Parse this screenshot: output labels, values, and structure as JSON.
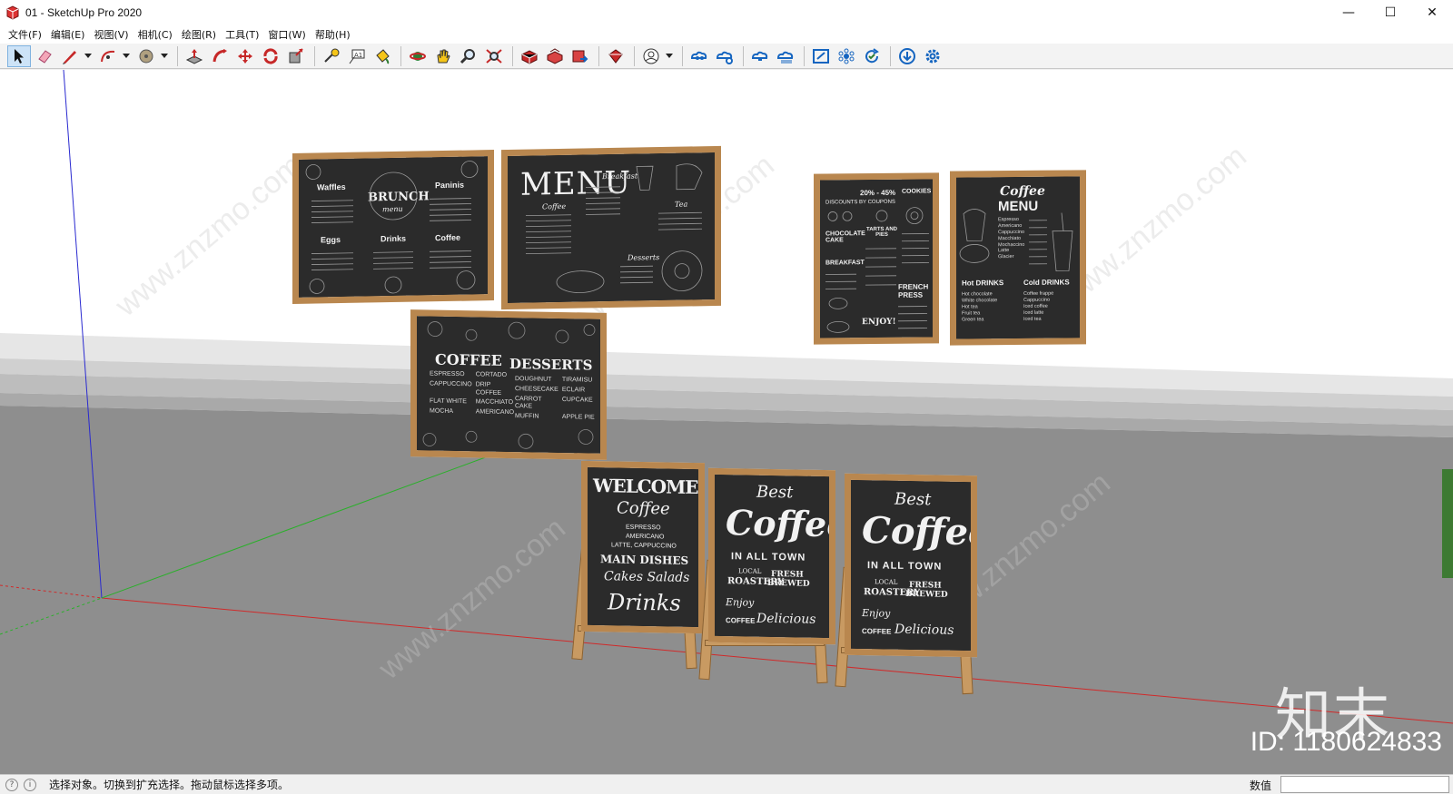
{
  "window": {
    "title": "01 - SketchUp Pro 2020",
    "controls": {
      "minimize": "—",
      "maximize": "☐",
      "close": "✕"
    }
  },
  "menu": {
    "items": [
      "文件(F)",
      "编辑(E)",
      "视图(V)",
      "相机(C)",
      "绘图(R)",
      "工具(T)",
      "窗口(W)",
      "帮助(H)"
    ]
  },
  "toolbar": {
    "tools": [
      {
        "icon": "select-arrow-icon",
        "selected": true
      },
      {
        "icon": "eraser-icon"
      },
      {
        "icon": "pencil-line-icon",
        "dropdown": true
      },
      {
        "icon": "arc-icon",
        "dropdown": true
      },
      {
        "icon": "shape-circle-icon",
        "dropdown": true
      },
      {
        "icon": "push-pull-icon"
      },
      {
        "icon": "follow-me-icon"
      },
      {
        "icon": "move-icon"
      },
      {
        "icon": "rotate-icon"
      },
      {
        "icon": "scale-icon"
      },
      {
        "icon": "tape-measure-icon"
      },
      {
        "icon": "text-icon"
      },
      {
        "icon": "paint-bucket-icon"
      },
      {
        "icon": "orbit-icon"
      },
      {
        "icon": "pan-icon"
      },
      {
        "icon": "zoom-icon"
      },
      {
        "icon": "zoom-extents-icon"
      },
      {
        "icon": "warehouse-icon"
      },
      {
        "icon": "extension-warehouse-icon"
      },
      {
        "icon": "send-to-layout-icon"
      },
      {
        "icon": "extension-manager-icon"
      },
      {
        "icon": "account-icon",
        "dropdown": true
      },
      {
        "icon": "trimble-connect-icon"
      },
      {
        "icon": "cloud-share-icon"
      },
      {
        "icon": "cloud-sync-icon"
      },
      {
        "icon": "cloud-upload-icon"
      },
      {
        "icon": "fit-view-icon"
      },
      {
        "icon": "components-icon"
      },
      {
        "icon": "refresh-check-icon"
      },
      {
        "icon": "download-icon"
      },
      {
        "icon": "settings-gear-icon"
      }
    ]
  },
  "scene": {
    "menus": {
      "brunch": {
        "title": "BRUNCH",
        "subtitle": "menu",
        "sections": [
          "Waffles",
          "Paninis",
          "Eggs",
          "Drinks",
          "Coffee"
        ]
      },
      "menu_board": {
        "title": "MENU",
        "sections": [
          "Breakfast",
          "Coffee",
          "Tea",
          "Desserts"
        ]
      },
      "discounts": {
        "headline": "20% - 45%",
        "line2": "DISCOUNTS BY COUPONS",
        "items": [
          "COOKIES",
          "CHOCOLATE CAKE",
          "TARTS AND PIES",
          "BREAKFAST",
          "FRENCH PRESS",
          "ENJOY!"
        ]
      },
      "coffee_menu": {
        "title_script": "Coffee",
        "title": "MENU",
        "hot": [
          "Espresso",
          "Americano",
          "Cappuccino",
          "Macchiato",
          "Mochaccino",
          "Latte",
          "Glacier"
        ],
        "hot_drinks_title": "Hot DRINKS",
        "cold_drinks_title": "Cold DRINKS",
        "hot_list": [
          "Hot chocolate",
          "White chocolate",
          "Hot tea",
          "Fruit tea",
          "Green tea"
        ],
        "cold_list": [
          "Coffee frappe",
          "Cappuccino",
          "Iced coffee",
          "Iced latte",
          "Iced tea"
        ]
      },
      "coffee_desserts": {
        "coffee_title": "COFFEE",
        "desserts_title": "DESSERTS",
        "coffee_items": [
          "ESPRESSO",
          "CORTADO",
          "CAPPUCCINO",
          "DRIP COFFEE",
          "FLAT WHITE",
          "MACCHIATO",
          "MOCHA",
          "AMERICANO"
        ],
        "dessert_items": [
          "DOUGHNUT",
          "TIRAMISU",
          "CHEESECAKE",
          "ECLAIR",
          "CARROT CAKE",
          "CUPCAKE",
          "MUFFIN",
          "APPLE PIE"
        ]
      },
      "welcome": {
        "title": "WELCOME",
        "script": "Coffee",
        "lines": [
          "ESPRESSO",
          "AMERICANO",
          "LATTE, CAPPUCCINO",
          "MAIN DISHES",
          "Cakes Salads",
          "Drinks"
        ]
      },
      "best_coffee": {
        "line1": "Best",
        "line2": "Coffee",
        "line3": "IN ALL TOWN",
        "extras": [
          "LOCAL",
          "ROASTERY",
          "FRESH",
          "BREWED",
          "Enjoy",
          "COFFEE",
          "Delicious"
        ]
      }
    },
    "watermarks": {
      "logo": "知末",
      "id_text": "ID: 1180624833",
      "site": "www.znzmo.com"
    }
  },
  "status": {
    "message": "选择对象。切换到扩充选择。拖动鼠标选择多项。",
    "measurements_label": "数值",
    "measurements_value": ""
  }
}
